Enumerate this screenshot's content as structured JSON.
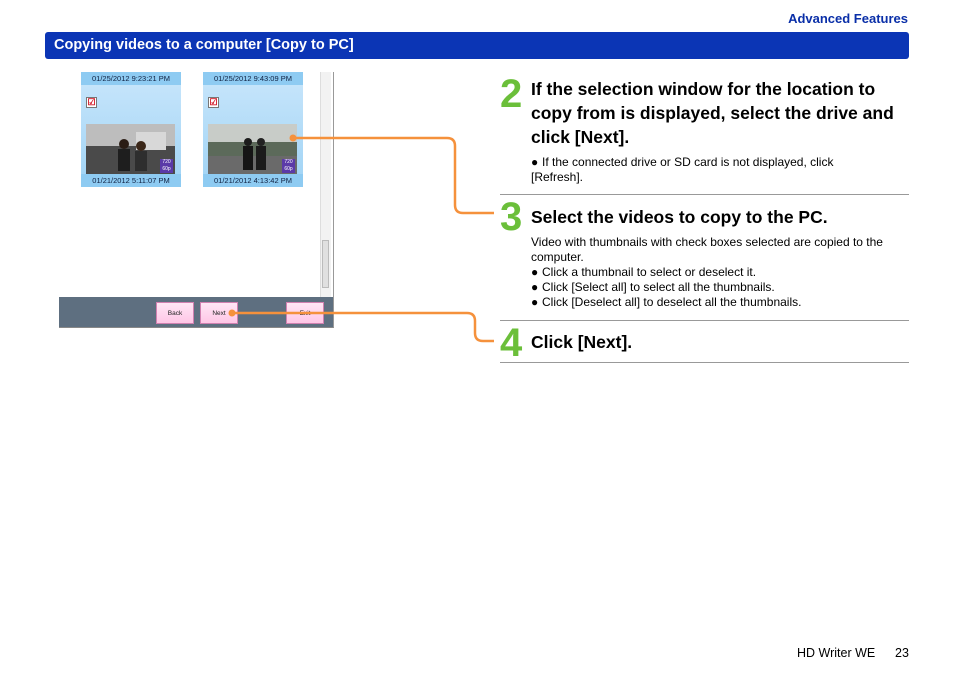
{
  "header": {
    "section": "Advanced Features",
    "title": "Copying videos to a computer [Copy to PC]"
  },
  "screenshot": {
    "thumbnails": [
      {
        "date_top": "01/25/2012 9:23:21 PM",
        "date_bottom": "01/21/2012 5:11:07 PM",
        "badge": "720 60p",
        "checked": "☑"
      },
      {
        "date_top": "01/25/2012 9:43:09 PM",
        "date_bottom": "01/21/2012 4:13:42 PM",
        "badge": "720 60p",
        "checked": "☑"
      }
    ],
    "buttons": {
      "back": "Back",
      "next": "Next",
      "exit": "Exit"
    }
  },
  "steps": [
    {
      "number": "2",
      "heading": "If the selection window for the location to copy from is displayed, select the drive and click [Next].",
      "bullets": [
        "If the connected drive or SD card is not displayed, click [Refresh]."
      ]
    },
    {
      "number": "3",
      "heading": "Select the videos to copy to the PC.",
      "text": "Video with thumbnails with check boxes selected are copied to the computer.",
      "bullets": [
        "Click a thumbnail to select or deselect it.",
        "Click [Select all] to select all the thumbnails.",
        "Click [Deselect all] to deselect all the thumbnails."
      ]
    },
    {
      "number": "4",
      "heading": "Click [Next]."
    }
  ],
  "footer": {
    "product": "HD Writer WE",
    "page": "23"
  },
  "colors": {
    "accent_blue": "#0b35b5",
    "step_green": "#6bbf3a",
    "callout_orange": "#f5913c"
  }
}
